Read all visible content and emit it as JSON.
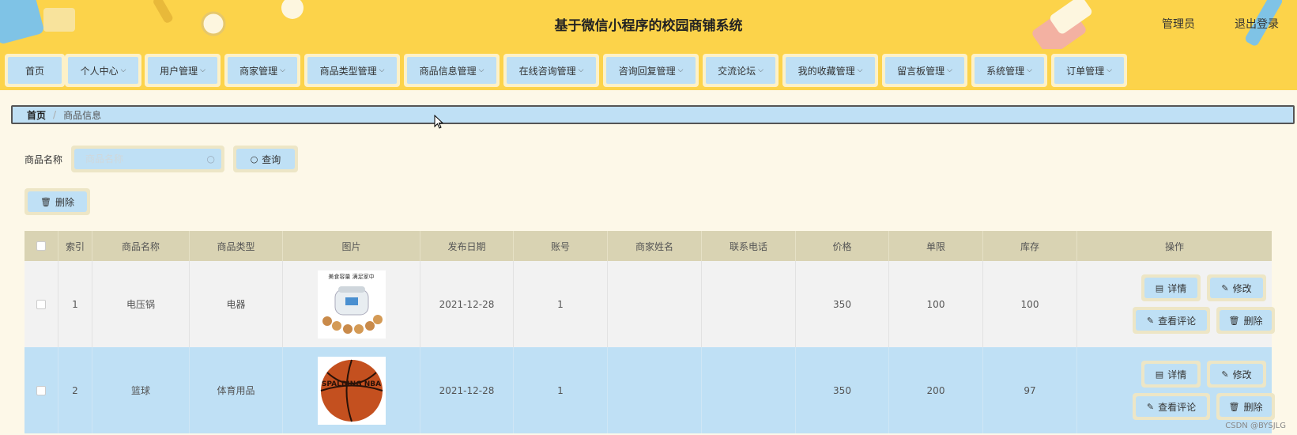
{
  "header": {
    "title": "基于微信小程序的校园商铺系统",
    "admin": "管理员",
    "logout": "退出登录"
  },
  "nav": [
    {
      "label": "首页",
      "has_dropdown": false
    },
    {
      "label": "个人中心",
      "has_dropdown": true
    },
    {
      "label": "用户管理",
      "has_dropdown": true
    },
    {
      "label": "商家管理",
      "has_dropdown": true
    },
    {
      "label": "商品类型管理",
      "has_dropdown": true
    },
    {
      "label": "商品信息管理",
      "has_dropdown": true
    },
    {
      "label": "在线咨询管理",
      "has_dropdown": true
    },
    {
      "label": "咨询回复管理",
      "has_dropdown": true
    },
    {
      "label": "交流论坛",
      "has_dropdown": true
    },
    {
      "label": "我的收藏管理",
      "has_dropdown": true
    },
    {
      "label": "留言板管理",
      "has_dropdown": true
    },
    {
      "label": "系统管理",
      "has_dropdown": true
    },
    {
      "label": "订单管理",
      "has_dropdown": true
    }
  ],
  "breadcrumb": {
    "home": "首页",
    "current": "商品信息"
  },
  "search": {
    "label": "商品名称",
    "placeholder": "商品名称",
    "query_button": "查询"
  },
  "delete_button": "删除",
  "table": {
    "columns": [
      "",
      "索引",
      "商品名称",
      "商品类型",
      "图片",
      "发布日期",
      "账号",
      "商家姓名",
      "联系电话",
      "价格",
      "单限",
      "库存",
      "操作"
    ],
    "rows": [
      {
        "index": "1",
        "name": "电压锅",
        "type": "电器",
        "image": "rice-cooker-image",
        "image_caption": "美食容量 满足家中",
        "date": "2021-12-28",
        "account": "1",
        "merchant": "",
        "phone": "",
        "price": "350",
        "limit": "100",
        "stock": "100"
      },
      {
        "index": "2",
        "name": "篮球",
        "type": "体育用品",
        "image": "basketball-image",
        "image_caption": "SPALDING NBA",
        "date": "2021-12-28",
        "account": "1",
        "merchant": "",
        "phone": "",
        "price": "350",
        "limit": "200",
        "stock": "97"
      }
    ],
    "actions": {
      "detail": "详情",
      "edit": "修改",
      "comments": "查看评论",
      "delete": "删除"
    }
  },
  "watermark": "CSDN @BYSJLG",
  "colors": {
    "header_bg": "#fcd34a",
    "button_bg": "#bfe0f5",
    "page_bg": "#fdf8e8",
    "row_selected": "#bfe0f5"
  }
}
